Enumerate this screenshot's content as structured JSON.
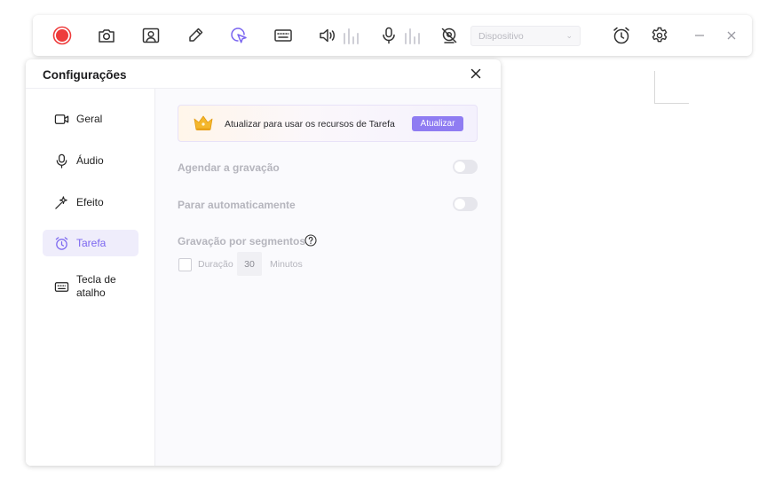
{
  "toolbar": {
    "device_placeholder": "Dispositivo",
    "accent_record": "#ee3b3b",
    "accent_active": "#7b66f0"
  },
  "dialog": {
    "title": "Configurações",
    "sidebar": [
      {
        "label": "Geral",
        "icon": "video-camera-icon"
      },
      {
        "label": "Áudio",
        "icon": "microphone-icon"
      },
      {
        "label": "Efeito",
        "icon": "magic-wand-icon"
      },
      {
        "label": "Tarefa",
        "icon": "alarm-clock-icon",
        "active": true
      },
      {
        "label": "Tecla de atalho",
        "icon": "keyboard-icon"
      }
    ],
    "banner": {
      "text": "Atualizar para usar os recursos de Tarefa",
      "button": "Atualizar",
      "icon": "crown-icon"
    },
    "options": {
      "schedule": {
        "label": "Agendar a gravação",
        "enabled": false
      },
      "auto_stop": {
        "label": "Parar automaticamente",
        "enabled": false
      },
      "segments": {
        "label": "Gravação por segmentos",
        "duration_label": "Duração",
        "duration_value": "30",
        "unit": "Minutos",
        "checked": false
      }
    }
  }
}
